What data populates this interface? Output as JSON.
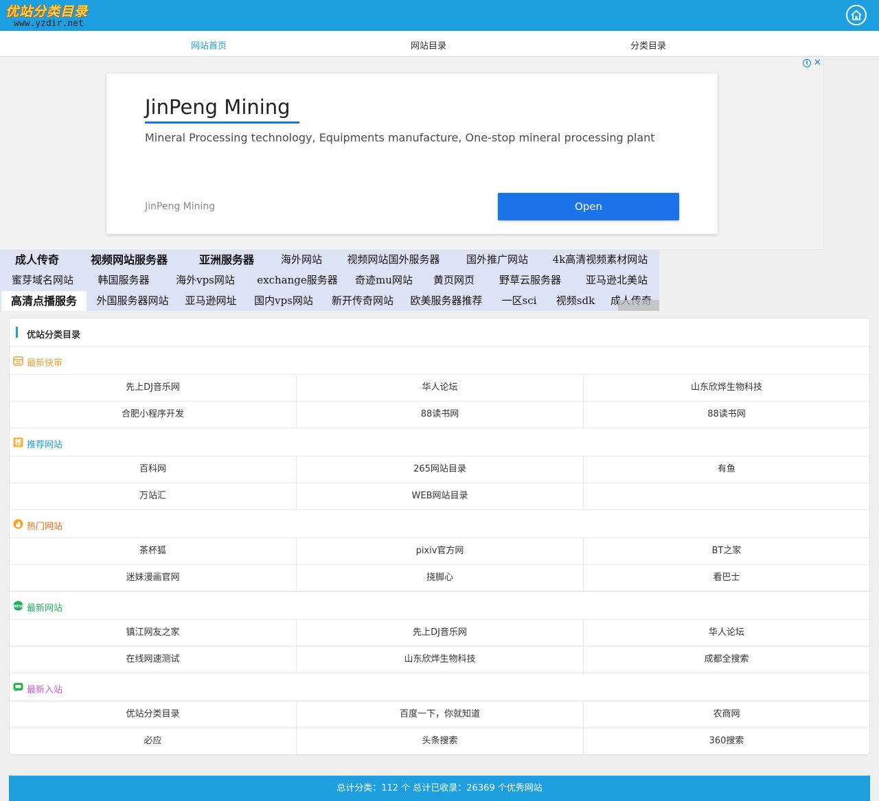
{
  "brand": {
    "logo_text": "优站分类目录",
    "logo_url": "www.yzdir.net",
    "accent_color": "#1e9fe0"
  },
  "header": {
    "home_icon": "home-icon"
  },
  "nav": {
    "items": [
      {
        "label": "网站首页",
        "active": true
      },
      {
        "label": "网站目录",
        "active": false
      },
      {
        "label": "分类目录",
        "active": false
      }
    ]
  },
  "ad": {
    "title": "JinPeng Mining",
    "description": "Mineral Processing technology, Equipments manufacture, One-stop mineral processing plant",
    "advertiser": "JinPeng Mining",
    "button_label": "Open",
    "choices_icon": "i",
    "close_icon": "✕"
  },
  "text_links": {
    "row1": [
      "成人传奇",
      "视频网站服务器",
      "亚洲服务器",
      "海外网站",
      "视频网站国外服务器",
      "国外推广网站",
      "4k高清视频素材网站"
    ],
    "row2": [
      "蜜芽域名网站",
      "韩国服务器",
      "海外vps网站",
      "exchange服务器",
      "奇迹mu网站",
      "黄页网页",
      "野草云服务器",
      "亚马逊北美站"
    ],
    "row3": [
      "高清点播服务",
      "外国服务器网站",
      "亚马逊网址",
      "国内vps网站",
      "新开传奇网站",
      "欧美服务器推荐",
      "一区sci",
      "视频sdk",
      "成人传奇"
    ]
  },
  "directory": {
    "title": "优站分类目录",
    "sections": [
      {
        "label": "最新快审",
        "icon": "calendar-icon",
        "color": "#e8a23a",
        "rows": [
          [
            "先上DJ音乐网",
            "华人论坛",
            "山东欣烨生物科技"
          ],
          [
            "合肥小程序开发",
            "88读书网",
            "88读书网"
          ]
        ]
      },
      {
        "label": "推荐网站",
        "icon": "recommend-icon",
        "color": "#1e9fe0",
        "rows": [
          [
            "百科网",
            "265网站目录",
            "有鱼"
          ],
          [
            "万站汇",
            "WEB网站目录",
            ""
          ]
        ]
      },
      {
        "label": "热门网站",
        "icon": "flame-icon",
        "color": "#f06a1e",
        "rows": [
          [
            "茶杯狐",
            "pixiv官方网",
            "BT之家"
          ],
          [
            "迷妹漫画官网",
            "挠脚心",
            "看巴士"
          ]
        ]
      },
      {
        "label": "最新网站",
        "icon": "new-badge-icon",
        "color": "#1fb25b",
        "rows": [
          [
            "镇江网友之家",
            "先上DJ音乐网",
            "华人论坛"
          ],
          [
            "在线网速测试",
            "山东欣烨生物科技",
            "成都全搜索"
          ]
        ]
      },
      {
        "label": "最新入站",
        "icon": "chat-bubble-icon",
        "color": "#c45bd6",
        "rows": [
          [
            "优站分类目录",
            "百度一下，你就知道",
            "农商网"
          ],
          [
            "必应",
            "头条搜索",
            "360搜索"
          ]
        ]
      }
    ]
  },
  "footer": {
    "text": "总计分类：112 个  总计已收录：26369 个优秀网站"
  }
}
